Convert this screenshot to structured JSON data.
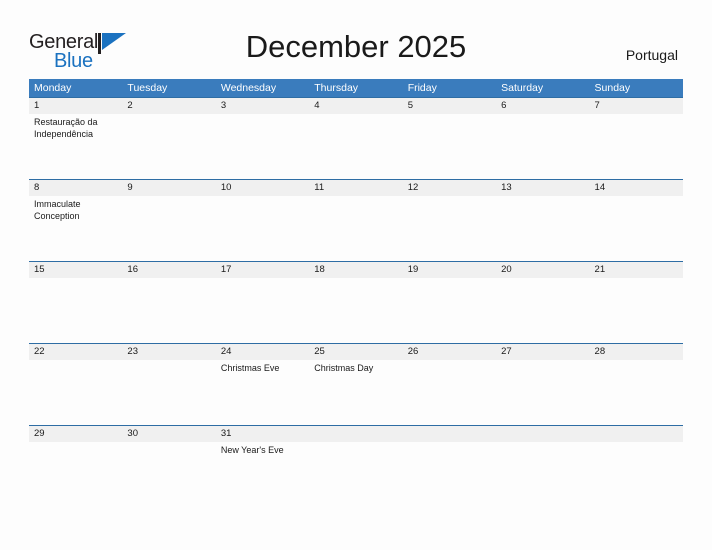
{
  "brand": {
    "name_part1": "General",
    "name_part2": "Blue",
    "flag_icon": "flag-triangle-icon",
    "accent_color": "#1b72c0"
  },
  "header": {
    "title": "December 2025",
    "country": "Portugal"
  },
  "theme": {
    "header_blue": "#3a7cbd",
    "rule_blue": "#2e6da4",
    "date_band_gray": "#f0f0f0",
    "page_background": "#fdfdfd"
  },
  "calendar": {
    "weekday_headers": [
      "Monday",
      "Tuesday",
      "Wednesday",
      "Thursday",
      "Friday",
      "Saturday",
      "Sunday"
    ],
    "weeks": [
      {
        "dates": [
          "1",
          "2",
          "3",
          "4",
          "5",
          "6",
          "7"
        ],
        "events": [
          "Restauração da Independência",
          "",
          "",
          "",
          "",
          "",
          ""
        ]
      },
      {
        "dates": [
          "8",
          "9",
          "10",
          "11",
          "12",
          "13",
          "14"
        ],
        "events": [
          "Immaculate Conception",
          "",
          "",
          "",
          "",
          "",
          ""
        ]
      },
      {
        "dates": [
          "15",
          "16",
          "17",
          "18",
          "19",
          "20",
          "21"
        ],
        "events": [
          "",
          "",
          "",
          "",
          "",
          "",
          ""
        ]
      },
      {
        "dates": [
          "22",
          "23",
          "24",
          "25",
          "26",
          "27",
          "28"
        ],
        "events": [
          "",
          "",
          "Christmas Eve",
          "Christmas Day",
          "",
          "",
          ""
        ]
      },
      {
        "dates": [
          "29",
          "30",
          "31",
          "",
          "",
          "",
          ""
        ],
        "events": [
          "",
          "",
          "New Year's Eve",
          "",
          "",
          "",
          ""
        ]
      }
    ]
  }
}
